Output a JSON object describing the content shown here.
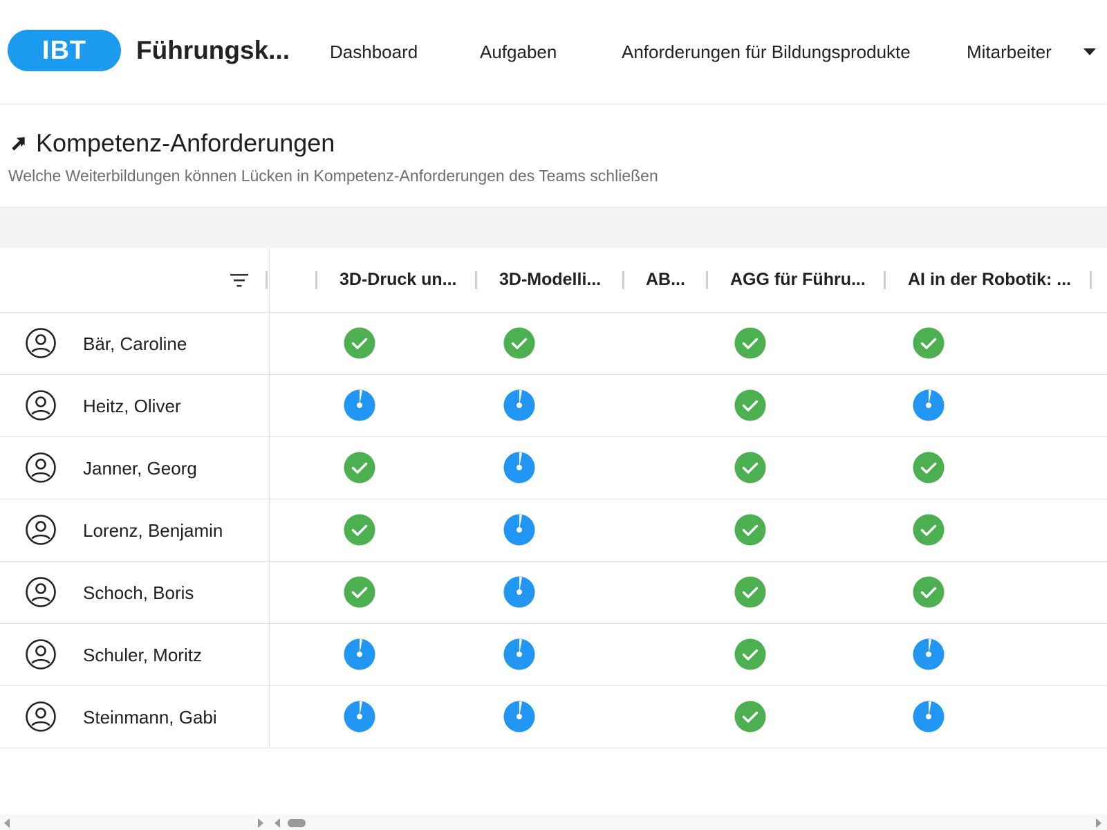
{
  "header": {
    "logo_text": "IBT",
    "app_title": "Führungsk...",
    "nav": [
      {
        "label": "Dashboard"
      },
      {
        "label": "Aufgaben"
      },
      {
        "label": "Anforderungen für Bildungsprodukte"
      },
      {
        "label": "Mitarbeiter"
      }
    ]
  },
  "page": {
    "title": "Kompetenz-Anforderungen",
    "subtitle": "Welche Weiterbildungen können Lücken in Kompetenz-Anforderungen des Teams schließen"
  },
  "grid": {
    "columns": [
      {
        "label": "3D-Druck un..."
      },
      {
        "label": "3D-Modelli..."
      },
      {
        "label": "AB..."
      },
      {
        "label": "AGG für Führu..."
      },
      {
        "label": "AI in der Robotik: ..."
      }
    ],
    "rows": [
      {
        "name": "Bär, Caroline",
        "status": [
          "done",
          "done",
          "none",
          "done",
          "done"
        ]
      },
      {
        "name": "Heitz, Oliver",
        "status": [
          "pending",
          "pending",
          "none",
          "done",
          "pending"
        ]
      },
      {
        "name": "Janner, Georg",
        "status": [
          "done",
          "pending",
          "none",
          "done",
          "done"
        ]
      },
      {
        "name": "Lorenz, Benjamin",
        "status": [
          "done",
          "pending",
          "none",
          "done",
          "done"
        ]
      },
      {
        "name": "Schoch, Boris",
        "status": [
          "done",
          "pending",
          "none",
          "done",
          "done"
        ]
      },
      {
        "name": "Schuler, Moritz",
        "status": [
          "pending",
          "pending",
          "none",
          "done",
          "pending"
        ]
      },
      {
        "name": "Steinmann, Gabi",
        "status": [
          "pending",
          "pending",
          "none",
          "done",
          "pending"
        ]
      }
    ]
  },
  "icons": {
    "heading": "arrow-up-right-icon",
    "filter": "filter-icon",
    "avatar": "user-avatar-icon",
    "done": "check-circle-icon",
    "pending": "progress-pie-icon",
    "nav_dropdown": "chevron-down-icon"
  },
  "colors": {
    "brand": "#1a9bf0",
    "done": "#4caf50",
    "pending": "#2196f3"
  }
}
